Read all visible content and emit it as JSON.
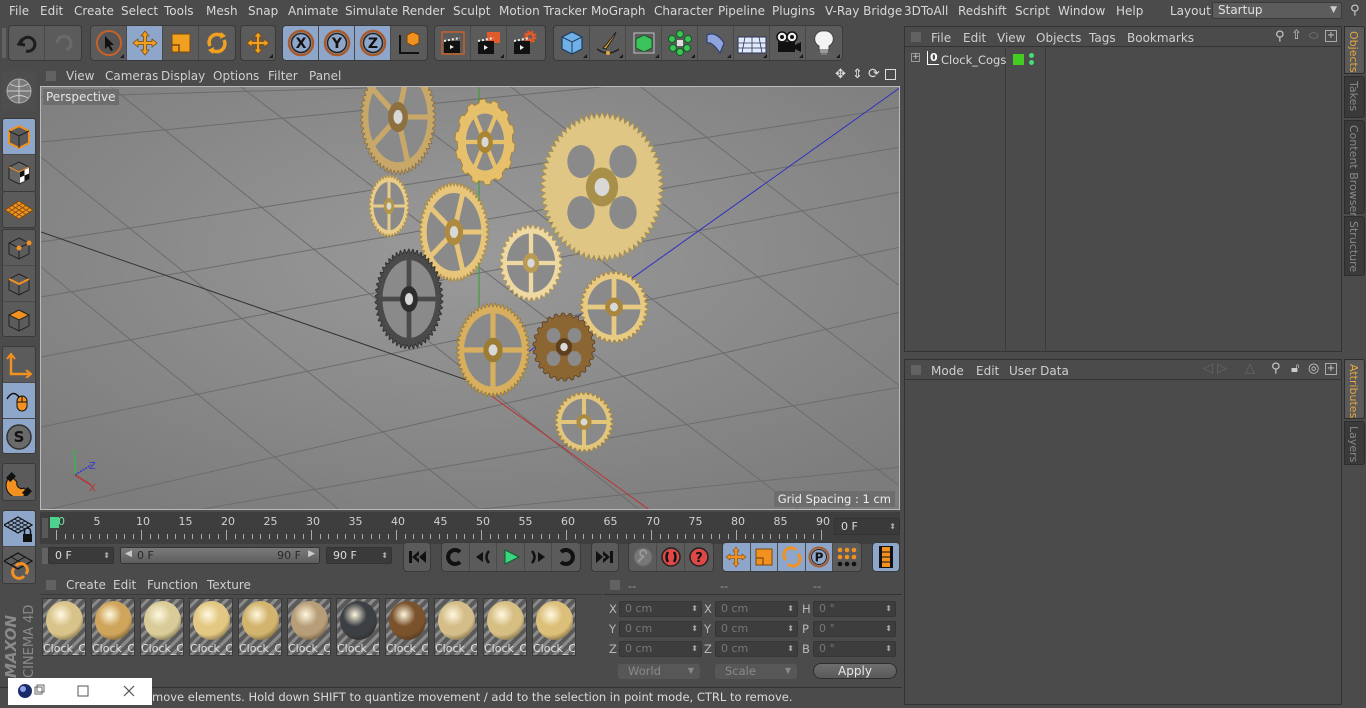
{
  "menubar": {
    "items": [
      "File",
      "Edit",
      "Create",
      "Select",
      "Tools",
      "Mesh",
      "Snap",
      "Animate",
      "Simulate",
      "Render",
      "Sculpt",
      "Motion Tracker",
      "MoGraph",
      "Character",
      "Pipeline",
      "Plugins",
      "V-Ray Bridge",
      "3DToAll",
      "Redshift",
      "Script",
      "Window",
      "Help"
    ],
    "layout_label": "Layout:",
    "layout_value": "Startup"
  },
  "toolbar": {
    "icons": [
      "undo-icon",
      "redo-icon",
      "live-selection-icon",
      "move-icon",
      "scale-icon",
      "rotate-icon",
      "recent-tool-icon",
      "x-axis-lock-icon",
      "y-axis-lock-icon",
      "z-axis-lock-icon",
      "coordinate-system-icon",
      "render-view-icon",
      "render-to-picture-viewer-icon",
      "render-settings-icon",
      "cube-icon",
      "pen-spline-icon",
      "subdivision-surface-icon",
      "cloner-icon",
      "bend-deformer-icon",
      "floor-icon",
      "camera-icon",
      "light-icon"
    ]
  },
  "left_toolbar": {
    "icons": [
      "make-editable-icon",
      "model-mode-icon",
      "texture-mode-icon",
      "workplane-icon",
      "points-mode-icon",
      "edges-mode-icon",
      "polygons-mode-icon",
      "axis-mode-icon",
      "tweak-mode-icon",
      "solo-mode-icon",
      "snapping-icon",
      "workplane-lock-icon",
      "workplane-align-icon"
    ]
  },
  "viewport": {
    "menu": [
      "View",
      "Cameras",
      "Display",
      "Options",
      "Filter",
      "Panel"
    ],
    "camera_label": "Perspective",
    "grid_spacing": "Grid Spacing : 1 cm",
    "axis_labels": {
      "x": "X",
      "y": "Y",
      "z": "Z"
    },
    "nav_icons": [
      "pan-icon",
      "zoom-icon",
      "orbit-icon",
      "maximize-view-icon"
    ]
  },
  "timeline": {
    "ticks": [
      "0",
      "5",
      "10",
      "15",
      "20",
      "25",
      "30",
      "35",
      "40",
      "45",
      "50",
      "55",
      "60",
      "65",
      "70",
      "75",
      "80",
      "85",
      "90"
    ],
    "current_frame_field": "0 F",
    "start_field": "0 F",
    "range_start": "0 F",
    "range_end": "90 F",
    "end_field": "90 F",
    "playhead_frame": 0,
    "max_frame": 90
  },
  "playback": {
    "icons": [
      "go-to-start-icon",
      "go-to-previous-keyframe-icon",
      "step-back-icon",
      "play-icon",
      "step-forward-icon",
      "go-to-next-keyframe-icon",
      "go-to-end-icon",
      "motion-record-icon",
      "record-active-objects-icon",
      "autokeying-icon",
      "record-position-icon",
      "record-scale-icon",
      "record-rotation-icon",
      "record-parameter-icon",
      "point-level-animation-icon",
      "timeline-icon"
    ]
  },
  "materials": {
    "menu": [
      "Create",
      "Edit",
      "Function",
      "Texture"
    ],
    "items": [
      {
        "label": "Clock_C",
        "color": "#d8c38a"
      },
      {
        "label": "Clock_C",
        "color": "#cfa55c"
      },
      {
        "label": "Clock_C",
        "color": "#d9cc98"
      },
      {
        "label": "Clock_C",
        "color": "#e3c883"
      },
      {
        "label": "Clock_C",
        "color": "#d2b46e"
      },
      {
        "label": "Clock_C",
        "color": "#b79e78"
      },
      {
        "label": "Clock_C",
        "color": "#3c3f44"
      },
      {
        "label": "Clock_C",
        "color": "#7a532d"
      },
      {
        "label": "Clock_C",
        "color": "#d4bd88"
      },
      {
        "label": "Clock_C",
        "color": "#d7bf84"
      },
      {
        "label": "Clock_C",
        "color": "#dcc07a"
      }
    ]
  },
  "coordinates": {
    "headers": [
      "--",
      "--",
      "--"
    ],
    "rows": [
      {
        "a": "X",
        "av": "0 cm",
        "b": "X",
        "bv": "0 cm",
        "c": "H",
        "cv": "0 °"
      },
      {
        "a": "Y",
        "av": "0 cm",
        "b": "Y",
        "bv": "0 cm",
        "c": "P",
        "cv": "0 °"
      },
      {
        "a": "Z",
        "av": "0 cm",
        "b": "Z",
        "bv": "0 cm",
        "c": "B",
        "cv": "0 °"
      }
    ],
    "space": "World",
    "mode": "Scale",
    "apply_label": "Apply"
  },
  "status": {
    "text": "move elements. Hold down SHIFT to quantize movement / add to the selection in point mode, CTRL to remove."
  },
  "objects_panel": {
    "menu": [
      "File",
      "Edit",
      "View",
      "Objects",
      "Tags",
      "Bookmarks"
    ],
    "objects": [
      {
        "name": "Clock_Cogs",
        "badge": "0",
        "color": "#44cc22"
      }
    ]
  },
  "attributes_panel": {
    "menu": [
      "Mode",
      "Edit",
      "User Data"
    ]
  },
  "side_tabs_top": [
    {
      "label": "Objects",
      "active": true
    },
    {
      "label": "Takes",
      "active": false
    },
    {
      "label": "Content Browser",
      "active": false
    },
    {
      "label": "Structure",
      "active": false
    }
  ],
  "side_tabs_bottom": [
    {
      "label": "Attributes",
      "active": true
    },
    {
      "label": "Layers",
      "active": false
    }
  ],
  "brand": {
    "maker": "MAXON",
    "product": "CINEMA 4D"
  }
}
